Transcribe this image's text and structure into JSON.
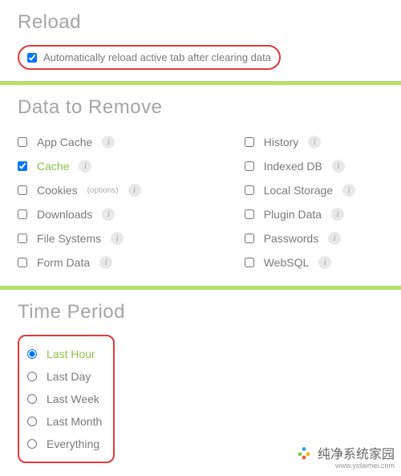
{
  "sections": {
    "reload": {
      "title": "Reload",
      "checkbox_label": "Automatically reload active tab after clearing data",
      "checked": true
    },
    "data": {
      "title": "Data to Remove",
      "left": [
        {
          "label": "App Cache",
          "checked": false,
          "info": true
        },
        {
          "label": "Cache",
          "checked": true,
          "info": true,
          "active": true
        },
        {
          "label": "Cookies",
          "checked": false,
          "info": true,
          "options": "(options)"
        },
        {
          "label": "Downloads",
          "checked": false,
          "info": true
        },
        {
          "label": "File Systems",
          "checked": false,
          "info": true
        },
        {
          "label": "Form Data",
          "checked": false,
          "info": true
        }
      ],
      "right": [
        {
          "label": "History",
          "checked": false,
          "info": true
        },
        {
          "label": "Indexed DB",
          "checked": false,
          "info": true
        },
        {
          "label": "Local Storage",
          "checked": false,
          "info": true
        },
        {
          "label": "Plugin Data",
          "checked": false,
          "info": true
        },
        {
          "label": "Passwords",
          "checked": false,
          "info": true
        },
        {
          "label": "WebSQL",
          "checked": false,
          "info": true
        }
      ]
    },
    "time": {
      "title": "Time Period",
      "options": [
        {
          "label": "Last Hour",
          "selected": true
        },
        {
          "label": "Last Day",
          "selected": false
        },
        {
          "label": "Last Week",
          "selected": false
        },
        {
          "label": "Last Month",
          "selected": false
        },
        {
          "label": "Everything",
          "selected": false
        }
      ]
    }
  },
  "info_glyph": "i",
  "watermark": {
    "text": "纯净系统家园",
    "url": "www.yidaimei.com"
  }
}
